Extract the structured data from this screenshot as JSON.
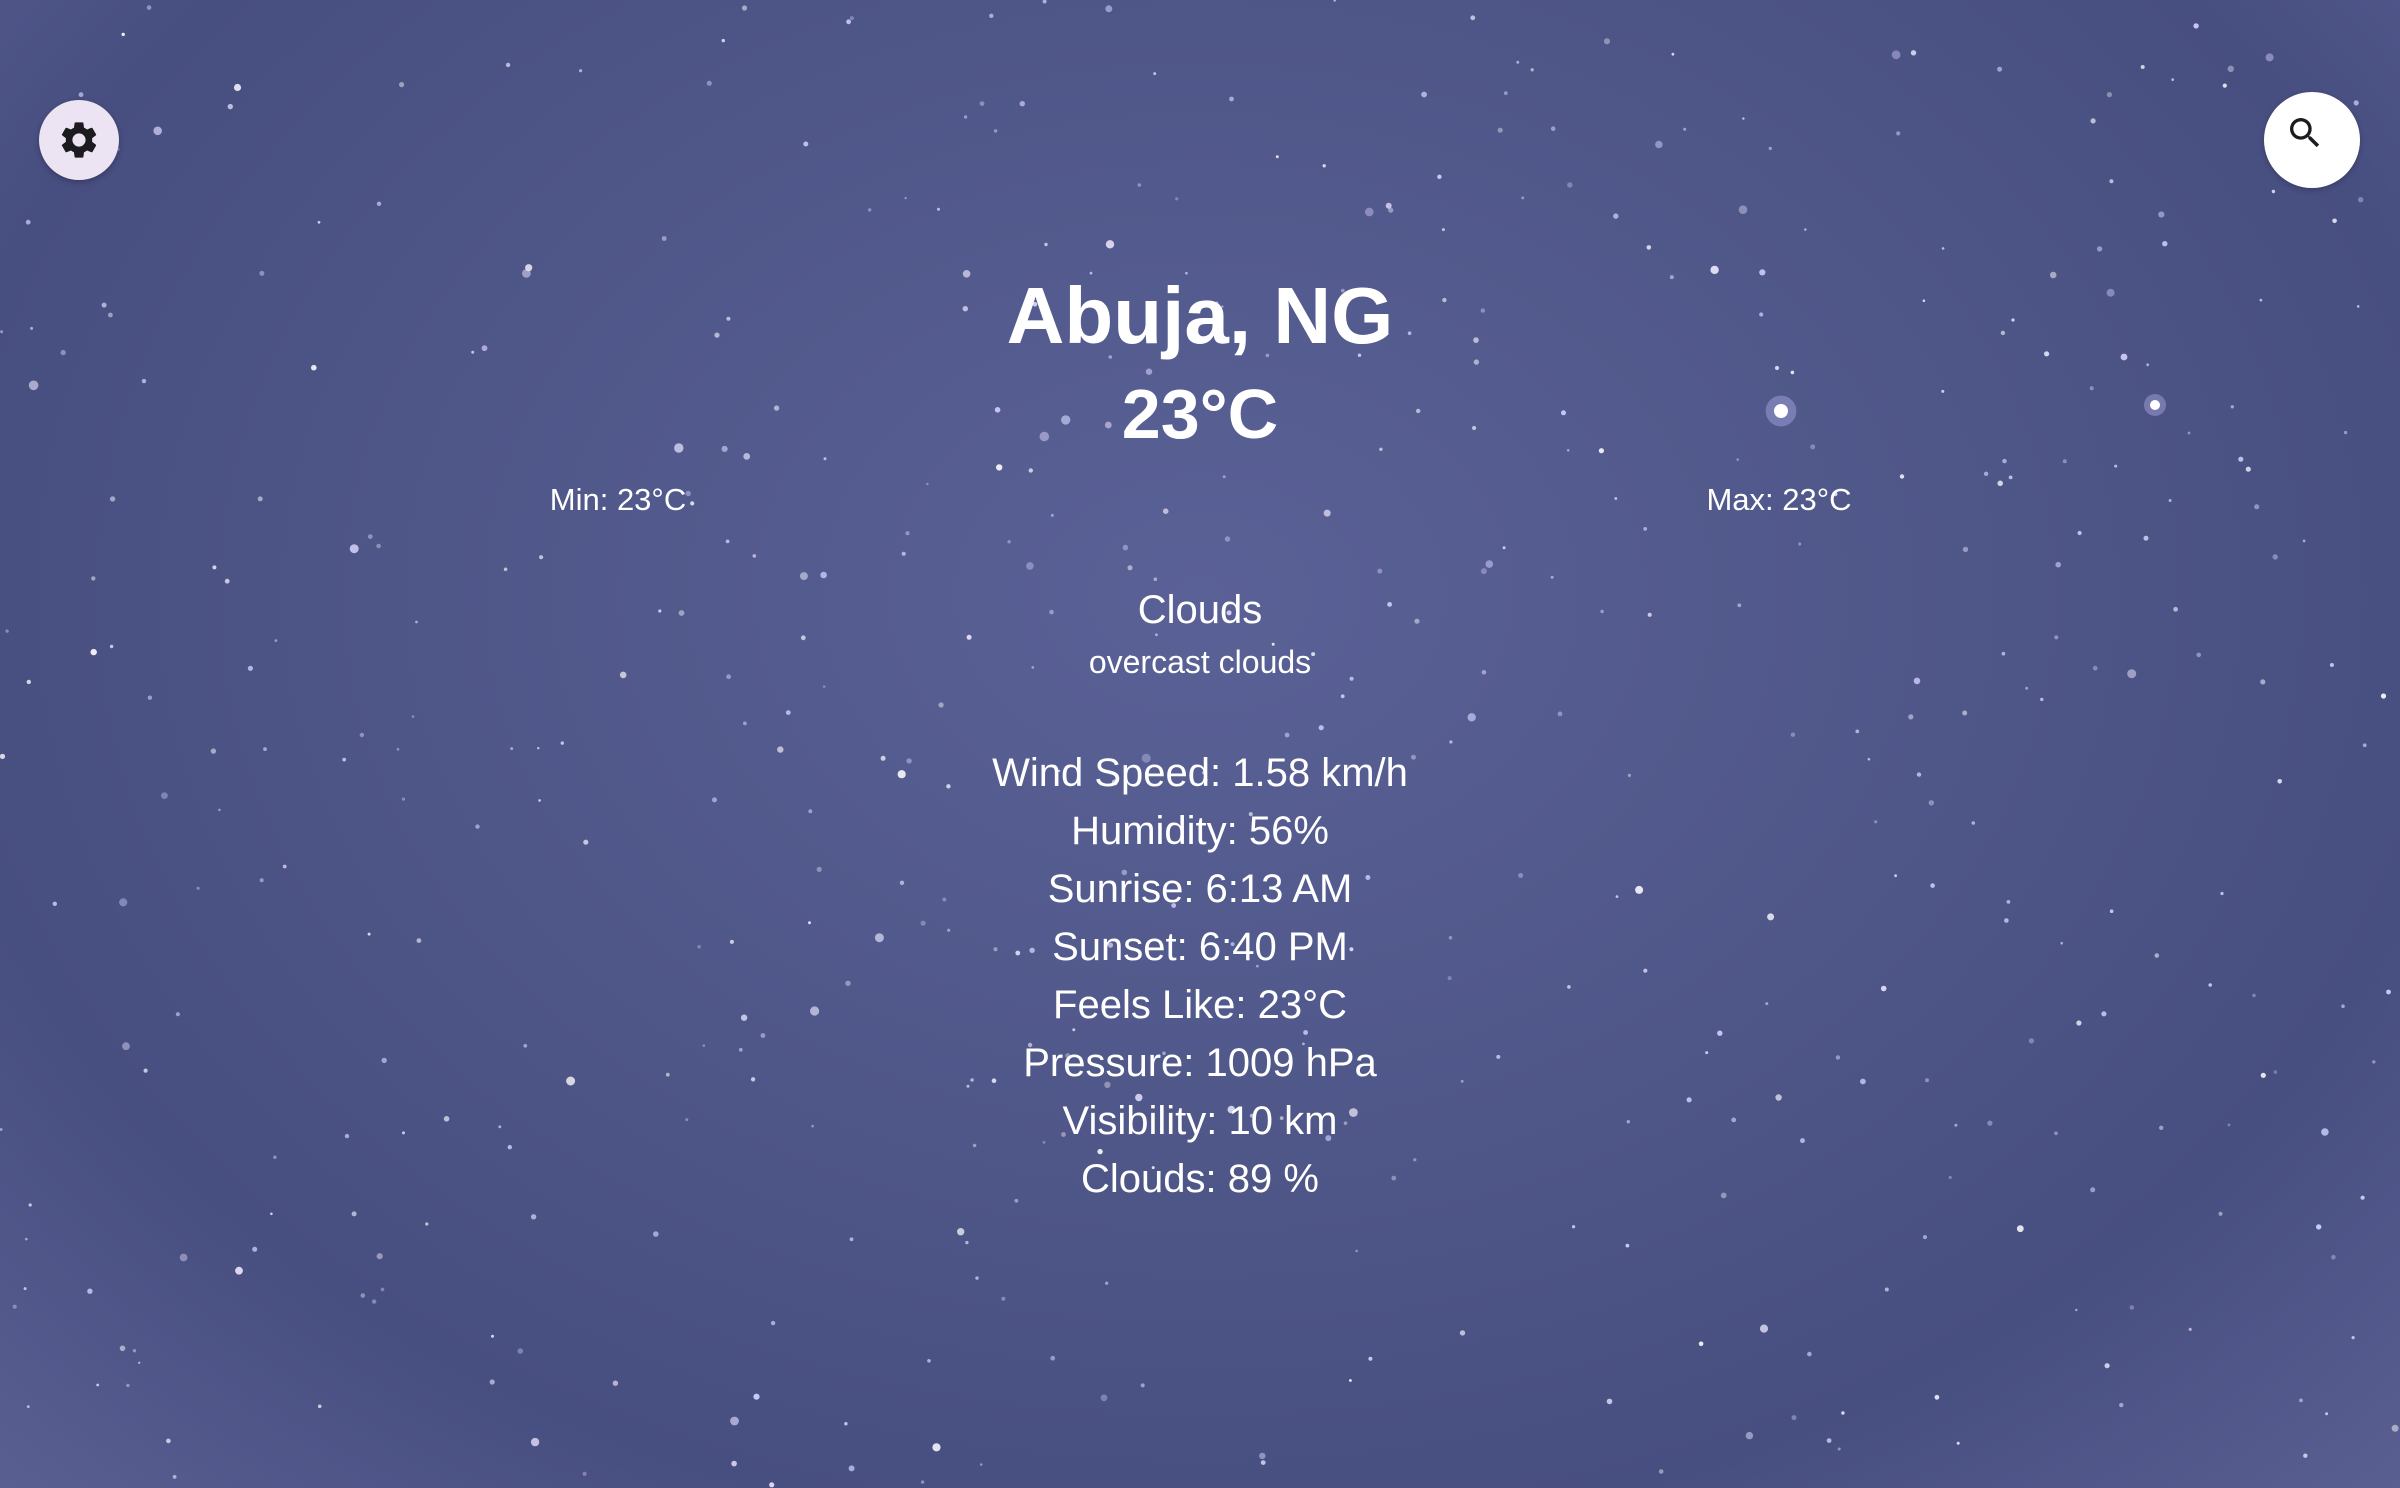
{
  "location": {
    "city": "Abuja, NG",
    "temperature": "23°C",
    "min": "Min: 23°C",
    "max": "Max: 23°C"
  },
  "weather": {
    "main": "Clouds",
    "description": "overcast clouds"
  },
  "details": [
    "Wind Speed: 1.58 km/h",
    "Humidity: 56%",
    "Sunrise: 6:13 AM",
    "Sunset: 6:40 PM",
    "Feels Like: 23°C",
    "Pressure: 1009 hPa",
    "Visibility: 10 km",
    "Clouds: 89 %"
  ],
  "icons": {
    "settings": "gear-icon",
    "search": "search-icon"
  },
  "colors": {
    "background": "#4f5688",
    "settings_button_bg": "#ece4f3",
    "icon": "#1c1b1f",
    "text": "#ffffff"
  }
}
